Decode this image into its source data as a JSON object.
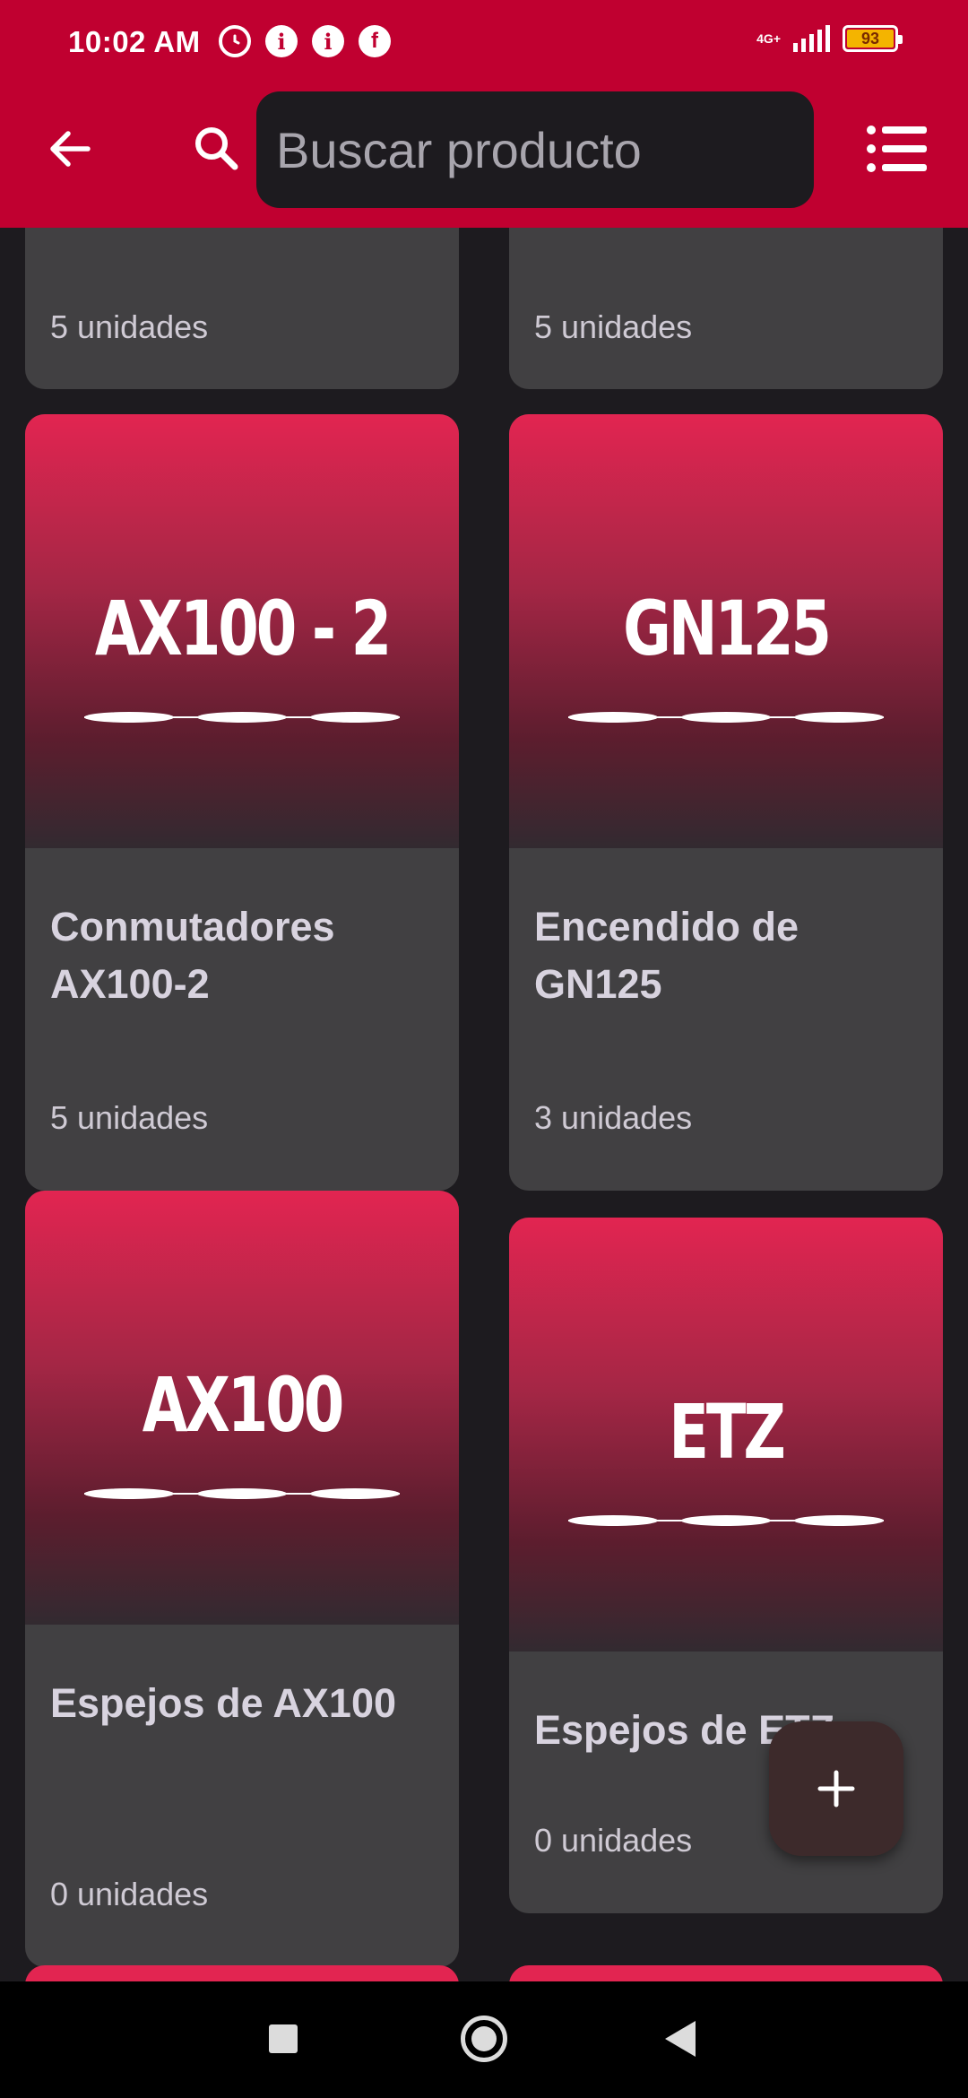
{
  "status_bar": {
    "time": "10:02 AM",
    "network": "4G+",
    "battery": "93",
    "notification_icons": [
      "alarm-icon",
      "info-icon",
      "info-icon",
      "facebook-icon"
    ]
  },
  "top_bar": {
    "search_placeholder": "Buscar producto"
  },
  "colors": {
    "primary": "#c00030",
    "background": "#1d1b1f",
    "card": "#414042",
    "banner_top": "#e22551",
    "banner_bottom": "#322a30",
    "fab": "#3d2a2b"
  },
  "products": [
    {
      "brand": "",
      "name": "",
      "quantity": "5 unidades"
    },
    {
      "brand": "",
      "name": "",
      "quantity": "5 unidades"
    },
    {
      "brand": "AX100 - 2",
      "name": "Conmutadores AX100-2",
      "quantity": "5 unidades"
    },
    {
      "brand": "GN125",
      "name": "Encendido de GN125",
      "quantity": "3 unidades"
    },
    {
      "brand": "AX100",
      "name": "Espejos de AX100",
      "quantity": "0 unidades"
    },
    {
      "brand": "ETZ",
      "name": "Espejos de ETZ",
      "quantity": "0 unidades"
    }
  ],
  "fab": {
    "icon": "plus-icon"
  }
}
